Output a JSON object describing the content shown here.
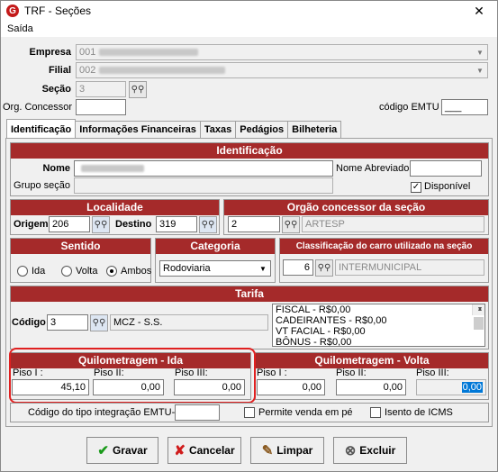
{
  "window": {
    "title": "TRF - Seções",
    "close_glyph": "✕"
  },
  "menu": {
    "saida": "Saída"
  },
  "header": {
    "empresa_label": "Empresa",
    "empresa_value": "001",
    "filial_label": "Filial",
    "filial_value": "002",
    "secao_label": "Seção",
    "secao_value": "3",
    "orgao_concessor_label": "Org. Concessor",
    "orgao_concessor_value": "",
    "codigo_emtu_label": "código EMTU",
    "codigo_emtu_value": "___"
  },
  "tabs": [
    "Identificação",
    "Informações Financeiras",
    "Taxas",
    "Pedágios",
    "Bilheteria"
  ],
  "identificacao": {
    "title": "Identificação",
    "nome_label": "Nome",
    "nome_abreviado_label": "Nome Abreviado",
    "grupo_secao_label": "Grupo seção",
    "disponivel_label": "Disponível",
    "disponivel_checked": true
  },
  "localidade": {
    "title": "Localidade",
    "origem_label": "Origem",
    "origem_value": "206",
    "destino_label": "Destino",
    "destino_value": "319"
  },
  "orgao": {
    "title": "Orgão concessor da seção",
    "code": "2",
    "name": "ARTESP"
  },
  "sentido": {
    "title": "Sentido",
    "options": [
      "Ida",
      "Volta",
      "Ambos"
    ],
    "selected": "Ambos"
  },
  "categoria": {
    "title": "Categoria",
    "value": "Rodoviaria"
  },
  "classificacao": {
    "title": "Classificação do carro utilizado na seção",
    "code": "6",
    "name": "INTERMUNICIPAL"
  },
  "tarifa": {
    "title": "Tarifa",
    "codigo_label": "Código",
    "codigo_value": "3",
    "name": "MCZ - S.S.",
    "items": [
      "FISCAL -  R$0,00",
      "CADEIRANTES -  R$0,00",
      "VT FACIAL -  R$0,00",
      "BÔNUS -  R$0,00"
    ]
  },
  "km_ida": {
    "title": "Quilometragem - Ida",
    "piso1_label": "Piso I :",
    "piso1": "45,10",
    "piso2_label": "Piso II:",
    "piso2": "0,00",
    "piso3_label": "Piso III:",
    "piso3": "0,00"
  },
  "km_volta": {
    "title": "Quilometragem - Volta",
    "piso1_label": "Piso I :",
    "piso1": "0,00",
    "piso2_label": "Piso II:",
    "piso2": "0,00",
    "piso3_label": "Piso III:",
    "piso3": "0,00"
  },
  "footer_fields": {
    "integracao_label": "Código do tipo integração EMTU-SP",
    "permite_label": "Permite venda em pé",
    "isento_label": "Isento de ICMS"
  },
  "buttons": {
    "gravar": "Gravar",
    "cancelar": "Cancelar",
    "limpar": "Limpar",
    "excluir": "Excluir"
  },
  "colors": {
    "header_bg": "#a52a2a",
    "highlight": "#e02020"
  }
}
